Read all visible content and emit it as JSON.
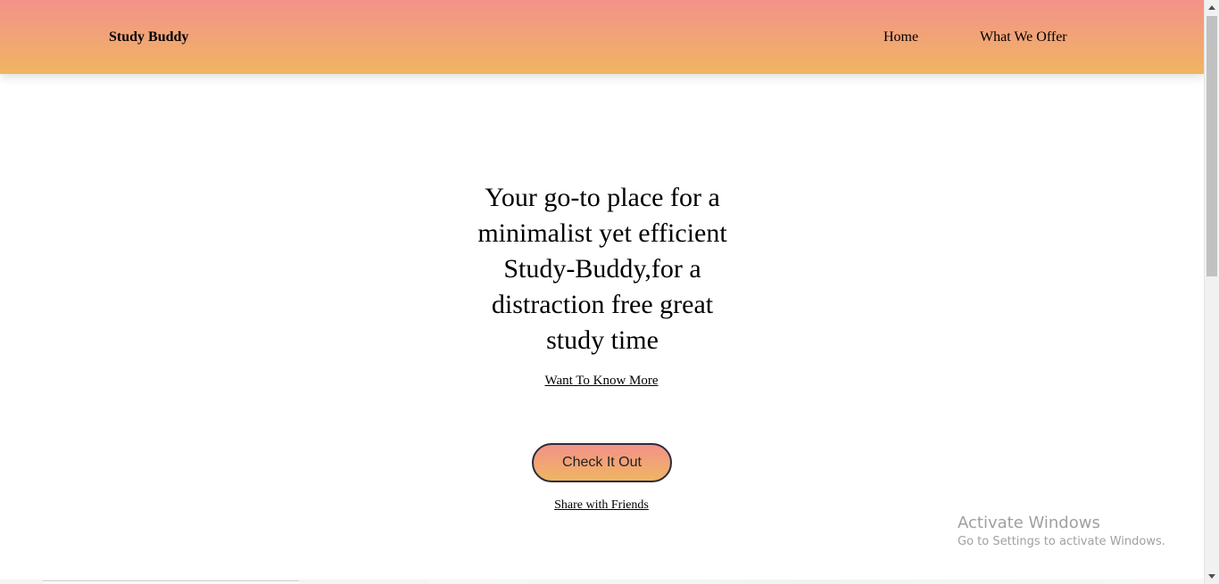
{
  "nav": {
    "brand": "Study Buddy",
    "links": [
      "Home",
      "What We Offer"
    ]
  },
  "hero": {
    "title": "Your go-to place for a minimalist yet efficient Study-Buddy,for a distraction free great study time",
    "know_more": "Want To Know More",
    "cta_label": "Check It Out",
    "share": "Share with Friends"
  },
  "watermark": {
    "title": "Activate Windows",
    "subtitle": "Go to Settings to activate Windows."
  },
  "colors": {
    "gradient_top": "#f3928a",
    "gradient_bottom": "#f0b562"
  }
}
